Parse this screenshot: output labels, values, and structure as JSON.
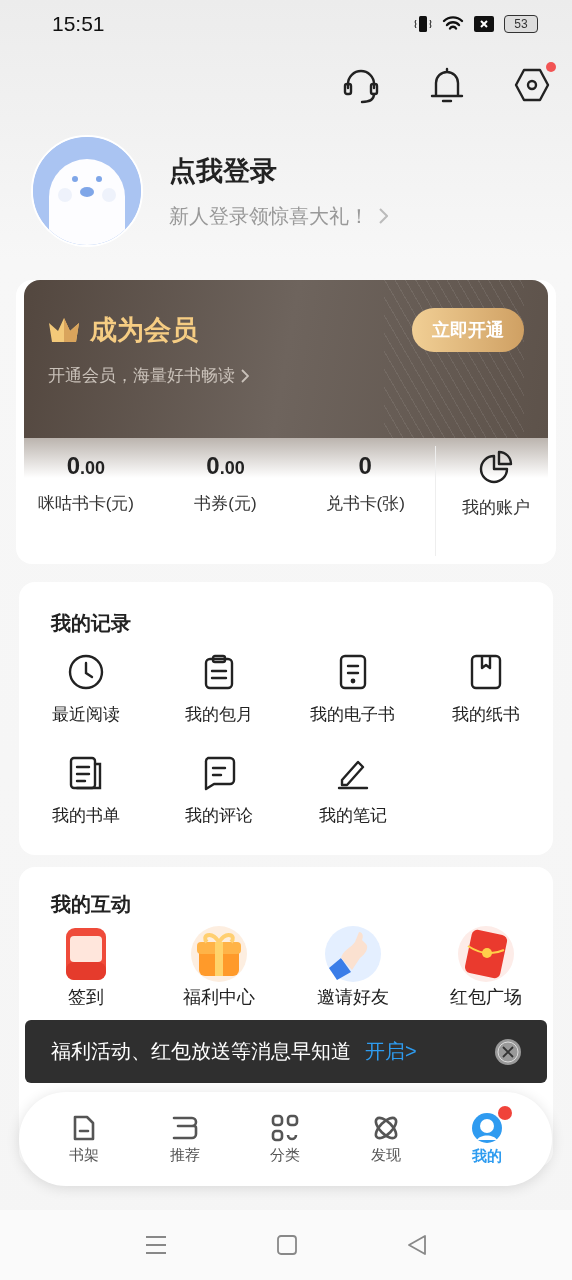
{
  "status_bar": {
    "time": "15:51",
    "battery": "53"
  },
  "header": {
    "settings_badge": true
  },
  "profile": {
    "title": "点我登录",
    "subtitle": "新人登录领惊喜大礼！"
  },
  "membership": {
    "title": "成为会员",
    "subtitle": "开通会员，海量好书畅读",
    "button": "立即开通"
  },
  "assets": [
    {
      "integer": "0",
      "fraction": ".00",
      "label": "咪咕书卡(元)"
    },
    {
      "integer": "0",
      "fraction": ".00",
      "label": "书券(元)"
    },
    {
      "integer": "0",
      "label": "兑书卡(张)"
    }
  ],
  "account": {
    "label": "我的账户"
  },
  "records": {
    "title": "我的记录",
    "items": [
      {
        "label": "最近阅读",
        "kind": "clock"
      },
      {
        "label": "我的包月",
        "kind": "clipboard"
      },
      {
        "label": "我的电子书",
        "kind": "ebook"
      },
      {
        "label": "我的纸书",
        "kind": "book"
      },
      {
        "label": "我的书单",
        "kind": "booklist"
      },
      {
        "label": "我的评论",
        "kind": "comment"
      },
      {
        "label": "我的笔记",
        "kind": "note"
      }
    ]
  },
  "interactions": {
    "title": "我的互动",
    "items": [
      {
        "label": "签到",
        "kind": "calendar"
      },
      {
        "label": "福利中心",
        "kind": "gift"
      },
      {
        "label": "邀请好友",
        "kind": "hand"
      },
      {
        "label": "红包广场",
        "kind": "envelope"
      }
    ]
  },
  "toast": {
    "text": "福利活动、红包放送等消息早知道",
    "action": "开启>"
  },
  "tabs": [
    {
      "label": "书架",
      "kind": "shelf",
      "selected": false,
      "badge": false
    },
    {
      "label": "推荐",
      "kind": "recommend",
      "selected": false,
      "badge": false
    },
    {
      "label": "分类",
      "kind": "category",
      "selected": false,
      "badge": false
    },
    {
      "label": "发现",
      "kind": "discover",
      "selected": false,
      "badge": false
    },
    {
      "label": "我的",
      "kind": "me",
      "selected": true,
      "badge": true
    }
  ]
}
